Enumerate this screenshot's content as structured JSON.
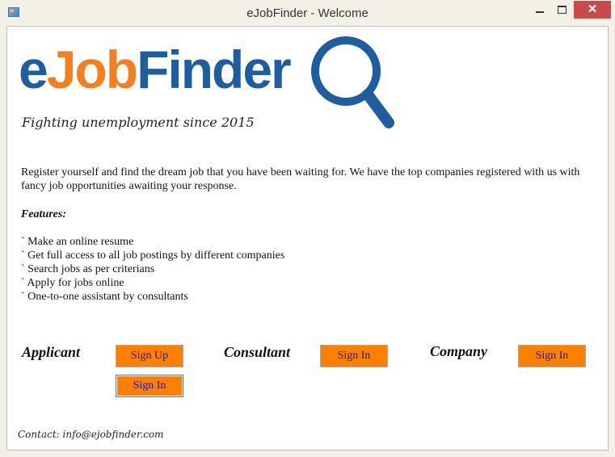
{
  "window": {
    "title": "eJobFinder - Welcome",
    "close_glyph": "✕"
  },
  "logo": {
    "part1": "e",
    "part2": "Job",
    "part3": "Finder",
    "tagline": "Fighting unemployment since 2015",
    "colors": {
      "blue": "#1f5e9e",
      "orange": "#f47f20"
    }
  },
  "intro": "Register yourself and find the dream job that you have been waiting for. We have the top companies registered with us with fancy job opportunities awaiting your response.",
  "features": {
    "heading": "Features:",
    "items": [
      "` Make an online resume",
      "` Get full access to all job postings by different companies",
      "` Search jobs as per criterians",
      "` Apply for jobs online",
      "` One-to-one assistant by consultants"
    ]
  },
  "roles": {
    "applicant": {
      "label": "Applicant",
      "signup": "Sign Up",
      "signin": "Sign In"
    },
    "consultant": {
      "label": "Consultant",
      "signin": "Sign In"
    },
    "company": {
      "label": "Company",
      "signin": "Sign In"
    }
  },
  "contact": "Contact: info@ejobfinder.com",
  "colors": {
    "button_bg": "#ff8000",
    "button_text": "#1a1aa5"
  }
}
